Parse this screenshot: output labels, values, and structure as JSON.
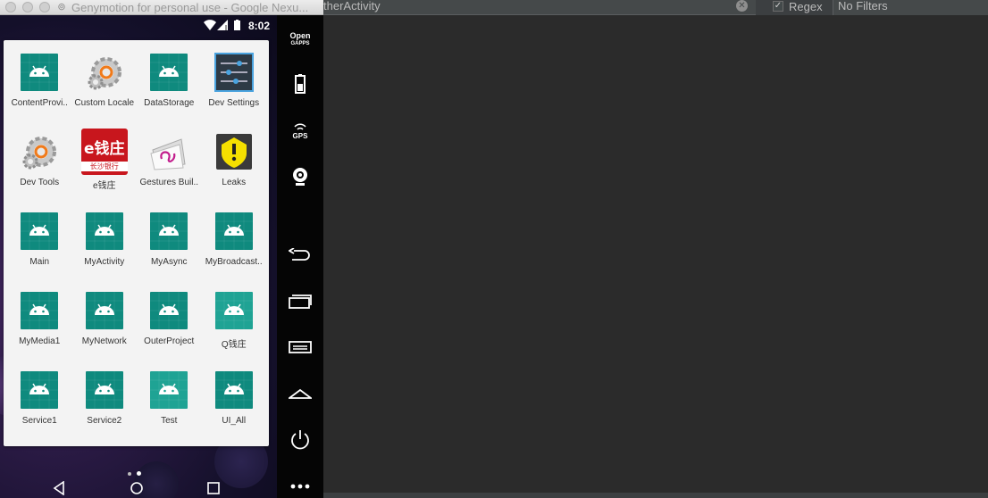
{
  "window": {
    "title": "Genymotion for personal use - Google Nexu..."
  },
  "statusbar": {
    "time": "8:02",
    "icons": [
      "wifi-icon",
      "signal-icon",
      "battery-icon"
    ]
  },
  "apps": [
    {
      "label": "ContentProvi..",
      "icon": "android"
    },
    {
      "label": "Custom Locale",
      "icon": "gears"
    },
    {
      "label": "DataStorage",
      "icon": "android"
    },
    {
      "label": "Dev Settings",
      "icon": "settings"
    },
    {
      "label": "Dev Tools",
      "icon": "gears"
    },
    {
      "label": "e钱庄",
      "icon": "ebank",
      "icon_text": "e钱庄",
      "icon_subtext": "长沙银行"
    },
    {
      "label": "Gestures Buil..",
      "icon": "gestures"
    },
    {
      "label": "Leaks",
      "icon": "leaks"
    },
    {
      "label": "Main",
      "icon": "android"
    },
    {
      "label": "MyActivity",
      "icon": "android"
    },
    {
      "label": "MyAsync",
      "icon": "android"
    },
    {
      "label": "MyBroadcast..",
      "icon": "android"
    },
    {
      "label": "MyMedia1",
      "icon": "android"
    },
    {
      "label": "MyNetwork",
      "icon": "android"
    },
    {
      "label": "OuterProject",
      "icon": "android"
    },
    {
      "label": "Q钱庄",
      "icon": "android-light"
    },
    {
      "label": "Service1",
      "icon": "android"
    },
    {
      "label": "Service2",
      "icon": "android"
    },
    {
      "label": "Test",
      "icon": "android-light"
    },
    {
      "label": "UI_All",
      "icon": "android"
    }
  ],
  "pager": {
    "pages": 2,
    "current": 2
  },
  "toolbar": {
    "opengapps_line1": "Open",
    "opengapps_line2": "GAPPS",
    "gps_label": "GPS"
  },
  "logcat": {
    "search_value": "therActivity",
    "regex_label": "Regex",
    "regex_checked": true,
    "filter_value": "No Filters"
  },
  "colors": {
    "android_tile": "#0f8a7e",
    "android_tile_light": "#1fa394",
    "ide_bg": "#2b2b2b"
  }
}
